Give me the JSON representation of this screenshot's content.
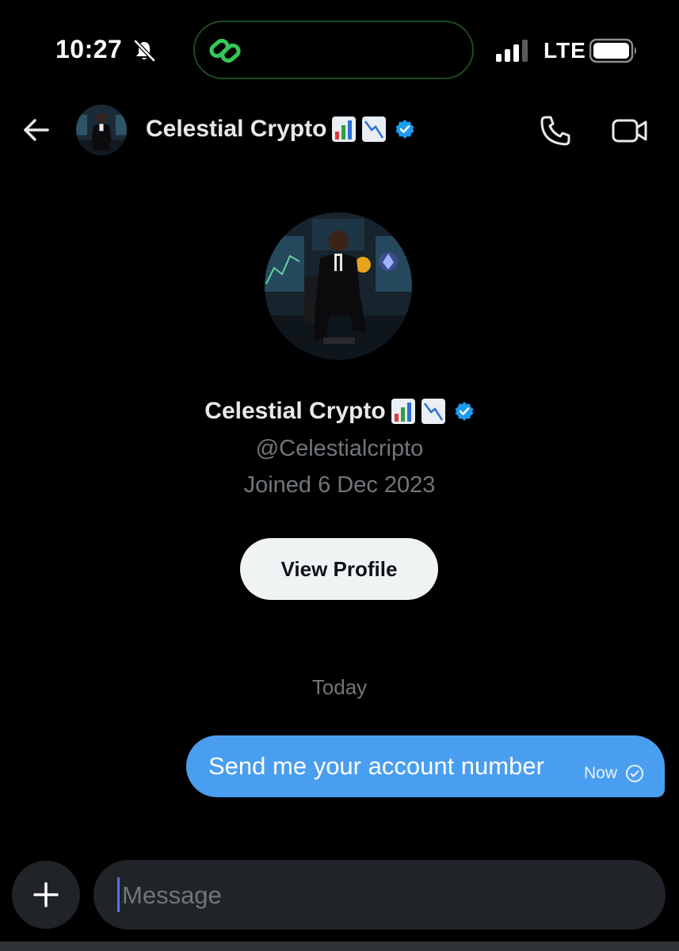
{
  "status_bar": {
    "time": "10:27",
    "network": "LTE",
    "icons": [
      "bell-slash-icon",
      "link-icon",
      "signal-icon",
      "battery-icon"
    ]
  },
  "header": {
    "name": "Celestial Crypto",
    "icons": [
      "back-arrow-icon",
      "chart-increasing-emoji",
      "chart-decreasing-emoji",
      "verified-badge-icon",
      "phone-icon",
      "video-icon"
    ]
  },
  "profile": {
    "name": "Celestial Crypto",
    "handle": "@Celestialcripto",
    "joined": "Joined 6 Dec 2023",
    "view_profile_label": "View Profile"
  },
  "conversation": {
    "day_label": "Today",
    "messages": [
      {
        "text": "Send me your account number",
        "time": "Now",
        "status_icon": "sent-check-icon"
      }
    ]
  },
  "composer": {
    "placeholder": "Message",
    "icons": [
      "plus-icon"
    ]
  },
  "colors": {
    "background": "#000000",
    "bubble": "#4a9ef0",
    "verified": "#1d9bf0",
    "button_bg": "#eff3f4",
    "muted_text": "#71767b",
    "island_border": "#1f4a22",
    "island_icon": "#34c759"
  }
}
